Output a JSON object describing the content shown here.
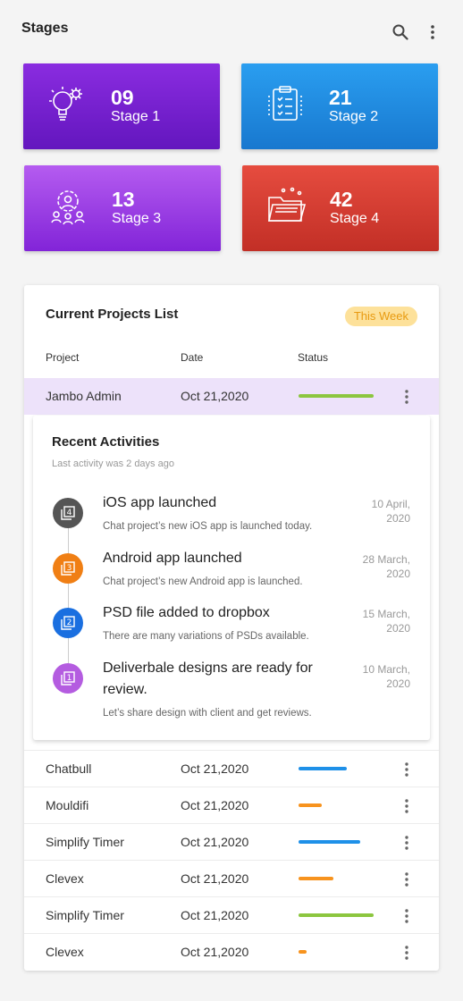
{
  "header": {
    "title": "Stages",
    "icons": [
      "search-icon",
      "more-vertical-icon"
    ]
  },
  "stages": [
    {
      "count": "09",
      "label": "Stage 1",
      "icon": "idea-gear-icon",
      "color": "#7320d0"
    },
    {
      "count": "21",
      "label": "Stage 2",
      "icon": "clipboard-checklist-icon",
      "color": "#1e8ae0"
    },
    {
      "count": "13",
      "label": "Stage 3",
      "icon": "team-gear-icon",
      "color": "#9c3fe6"
    },
    {
      "count": "42",
      "label": "Stage 4",
      "icon": "folder-open-icon",
      "color": "#d63d32"
    }
  ],
  "projects": {
    "title": "Current Projects List",
    "badge": "This Week",
    "columns": [
      "Project",
      "Date",
      "Status"
    ],
    "rows": [
      {
        "name": "Jambo Admin",
        "date": "Oct 21,2020",
        "progress": 0.93,
        "status_color": "#8cc63f"
      },
      {
        "name": "Chatbull",
        "date": "Oct 21,2020",
        "progress": 0.6,
        "status_color": "#1e90e8"
      },
      {
        "name": "Mouldifi",
        "date": "Oct 21,2020",
        "progress": 0.29,
        "status_color": "#f7931e"
      },
      {
        "name": "Simplify Timer",
        "date": "Oct 21,2020",
        "progress": 0.77,
        "status_color": "#1e90e8"
      },
      {
        "name": "Clevex",
        "date": "Oct 21,2020",
        "progress": 0.43,
        "status_color": "#f7931e"
      },
      {
        "name": "Simplify Timer",
        "date": "Oct 21,2020",
        "progress": 0.93,
        "status_color": "#8cc63f"
      },
      {
        "name": "Clevex",
        "date": "Oct 21,2020",
        "progress": 0.1,
        "status_color": "#f7931e"
      }
    ]
  },
  "activities": {
    "title": "Recent Activities",
    "subtitle": "Last activity was 2 days ago",
    "items": [
      {
        "title": "iOS app launched",
        "desc": "Chat project’s new iOS app is launched today.",
        "date": "10 April, 2020",
        "badge": "4",
        "color": "#555555"
      },
      {
        "title": "Android app launched",
        "desc": "Chat project’s new Android app is launched.",
        "date": "28 March, 2020",
        "badge": "3",
        "color": "#f07f14"
      },
      {
        "title": "PSD file added to dropbox",
        "desc": "There are many variations of PSDs available.",
        "date": "15 March, 2020",
        "badge": "2",
        "color": "#1a6fe0"
      },
      {
        "title": "Deliverbale designs are ready for review.",
        "desc": "Let’s share design with client and get reviews.",
        "date": "10 March, 2020",
        "badge": "1",
        "color": "#b45ce0"
      }
    ]
  }
}
